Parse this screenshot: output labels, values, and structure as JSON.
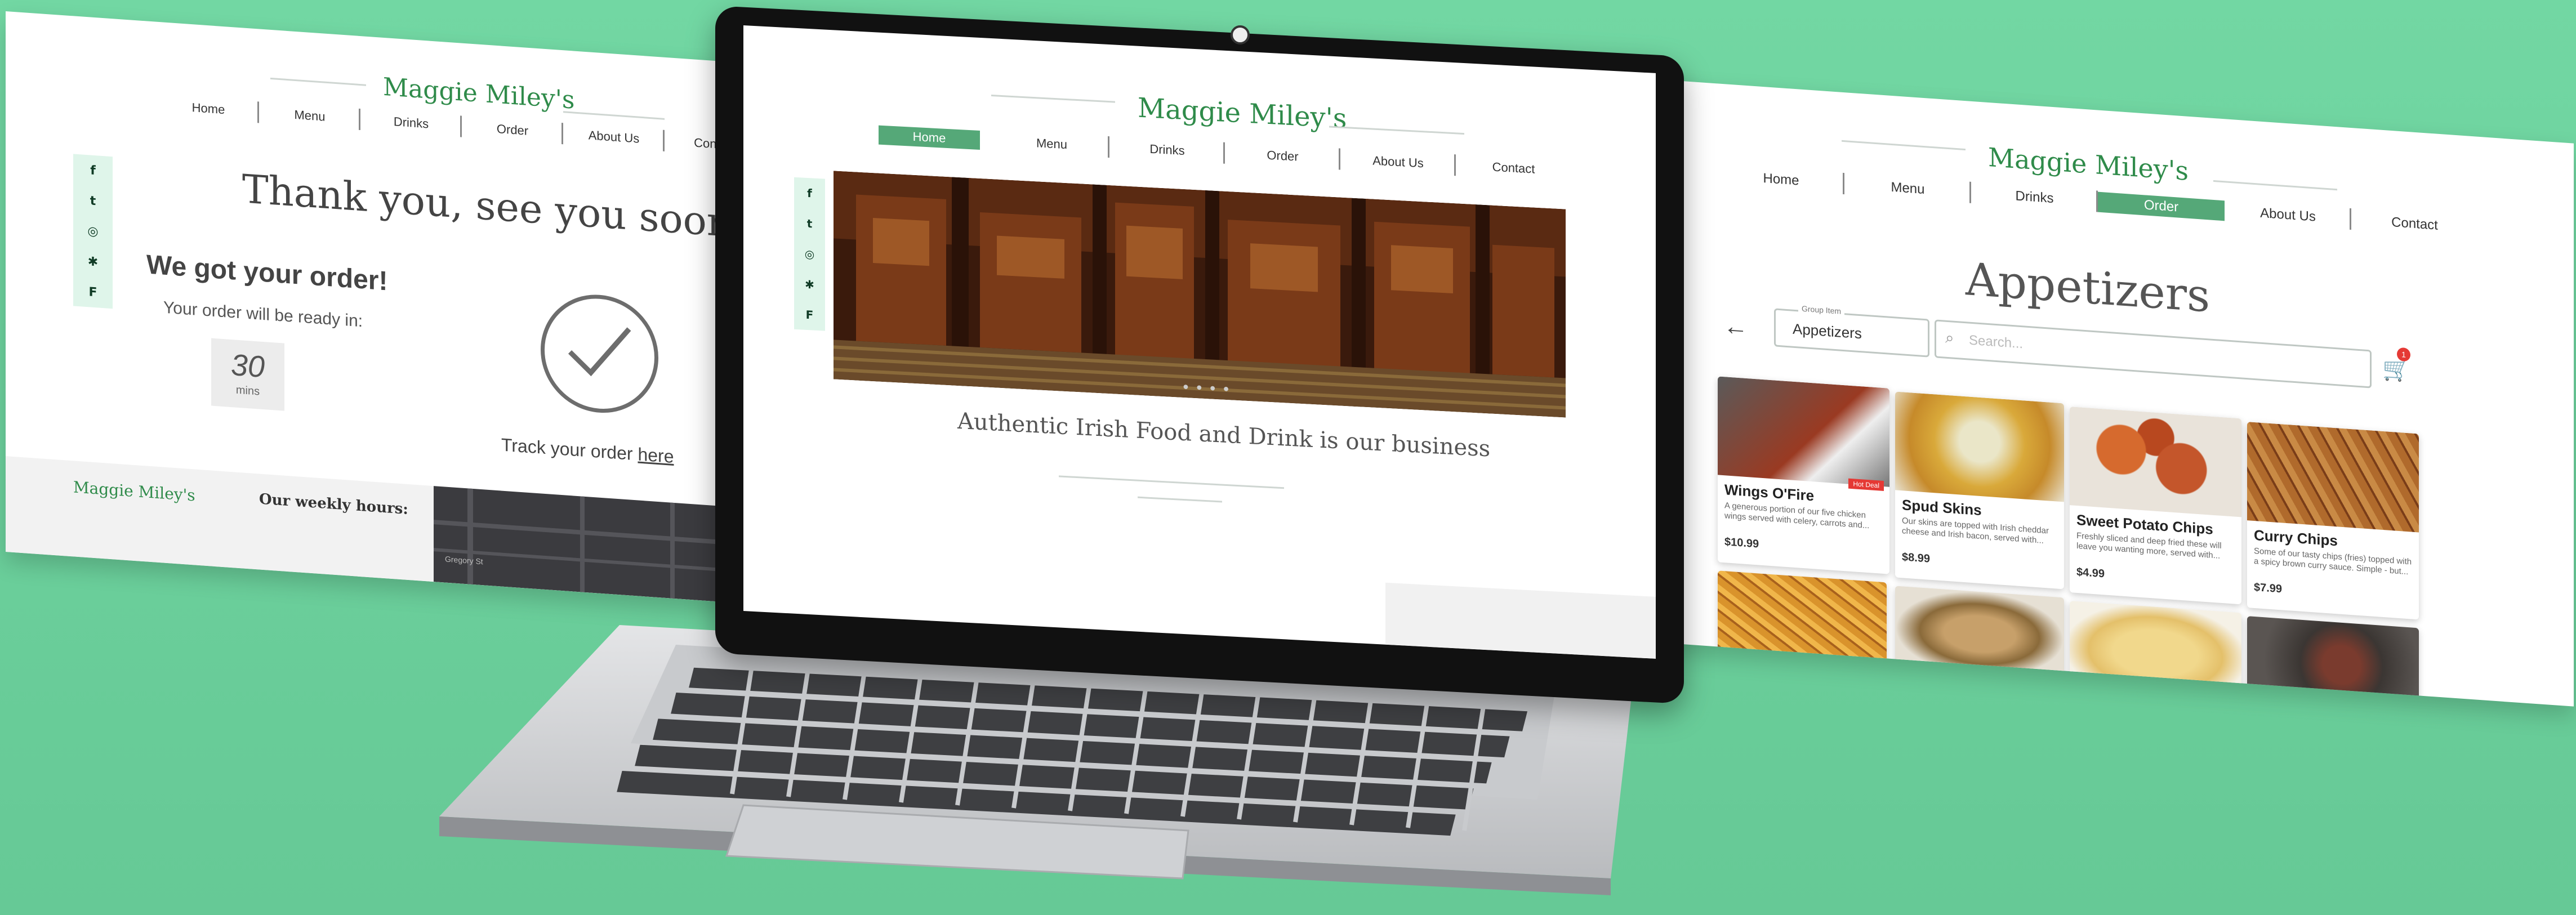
{
  "brand": "Maggie Miley's",
  "nav": [
    "Home",
    "Menu",
    "Drinks",
    "Order",
    "About Us",
    "Contact"
  ],
  "social_icons": [
    "facebook-icon",
    "twitter-icon",
    "instagram-icon",
    "yelp-icon",
    "foursquare-icon"
  ],
  "social_glyphs": [
    "f",
    "t",
    "◎",
    "✱",
    "F"
  ],
  "left_panel": {
    "headline": "Thank you, see you soon!",
    "confirmation": "We got your order!",
    "ready_label": "Your order will be ready in:",
    "ready_value": "30",
    "ready_unit": "mins",
    "track_prefix": "Track your order",
    "track_link": "here",
    "footer_brand": "Maggie Miley's",
    "footer_hours": "Our weekly hours:",
    "map_label": "Gregory St"
  },
  "center_screen": {
    "active_nav": "Home",
    "tagline": "Authentic Irish Food and Drink is our business",
    "carousel_dots": "● ● ● ●"
  },
  "right_panel": {
    "active_nav": "Order",
    "heading": "Appetizers",
    "group_label": "Group Item",
    "group_value": "Appetizers",
    "search_placeholder": "Search...",
    "cart_count": "1",
    "cards": [
      {
        "title": "Wings O'Fire",
        "tag": "Hot Deal",
        "desc": "A generous portion of our five chicken wings served with celery, carrots and...",
        "price": "$10.99",
        "color": "#8a2a1a"
      },
      {
        "title": "Spud Skins",
        "desc": "Our skins are topped with Irish cheddar cheese and Irish bacon, served with...",
        "price": "$8.99",
        "color": "#d9b34a"
      },
      {
        "title": "Sweet Potato Chips",
        "desc": "Freshly sliced and deep fried these will leave you wanting more, served with...",
        "price": "$4.99",
        "color": "#c4562b"
      },
      {
        "title": "Curry Chips",
        "desc": "Some of our tasty chips (fries) topped with a spicy brown curry sauce. Simple - but...",
        "price": "$7.99",
        "color": "#a8612a"
      }
    ],
    "photos": [
      "#b97a2a",
      "#caa36a",
      "#e8cf86",
      "#5a4638"
    ]
  }
}
